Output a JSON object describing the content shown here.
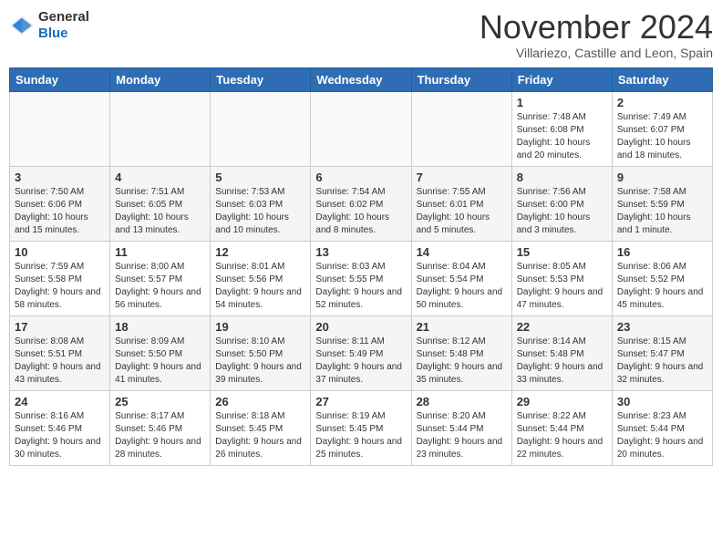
{
  "header": {
    "logo_line1": "General",
    "logo_line2": "Blue",
    "month_title": "November 2024",
    "subtitle": "Villariezo, Castille and Leon, Spain"
  },
  "days_of_week": [
    "Sunday",
    "Monday",
    "Tuesday",
    "Wednesday",
    "Thursday",
    "Friday",
    "Saturday"
  ],
  "weeks": [
    {
      "days": [
        {
          "date": "",
          "info": ""
        },
        {
          "date": "",
          "info": ""
        },
        {
          "date": "",
          "info": ""
        },
        {
          "date": "",
          "info": ""
        },
        {
          "date": "",
          "info": ""
        },
        {
          "date": "1",
          "info": "Sunrise: 7:48 AM\nSunset: 6:08 PM\nDaylight: 10 hours and 20 minutes."
        },
        {
          "date": "2",
          "info": "Sunrise: 7:49 AM\nSunset: 6:07 PM\nDaylight: 10 hours and 18 minutes."
        }
      ]
    },
    {
      "days": [
        {
          "date": "3",
          "info": "Sunrise: 7:50 AM\nSunset: 6:06 PM\nDaylight: 10 hours and 15 minutes."
        },
        {
          "date": "4",
          "info": "Sunrise: 7:51 AM\nSunset: 6:05 PM\nDaylight: 10 hours and 13 minutes."
        },
        {
          "date": "5",
          "info": "Sunrise: 7:53 AM\nSunset: 6:03 PM\nDaylight: 10 hours and 10 minutes."
        },
        {
          "date": "6",
          "info": "Sunrise: 7:54 AM\nSunset: 6:02 PM\nDaylight: 10 hours and 8 minutes."
        },
        {
          "date": "7",
          "info": "Sunrise: 7:55 AM\nSunset: 6:01 PM\nDaylight: 10 hours and 5 minutes."
        },
        {
          "date": "8",
          "info": "Sunrise: 7:56 AM\nSunset: 6:00 PM\nDaylight: 10 hours and 3 minutes."
        },
        {
          "date": "9",
          "info": "Sunrise: 7:58 AM\nSunset: 5:59 PM\nDaylight: 10 hours and 1 minute."
        }
      ]
    },
    {
      "days": [
        {
          "date": "10",
          "info": "Sunrise: 7:59 AM\nSunset: 5:58 PM\nDaylight: 9 hours and 58 minutes."
        },
        {
          "date": "11",
          "info": "Sunrise: 8:00 AM\nSunset: 5:57 PM\nDaylight: 9 hours and 56 minutes."
        },
        {
          "date": "12",
          "info": "Sunrise: 8:01 AM\nSunset: 5:56 PM\nDaylight: 9 hours and 54 minutes."
        },
        {
          "date": "13",
          "info": "Sunrise: 8:03 AM\nSunset: 5:55 PM\nDaylight: 9 hours and 52 minutes."
        },
        {
          "date": "14",
          "info": "Sunrise: 8:04 AM\nSunset: 5:54 PM\nDaylight: 9 hours and 50 minutes."
        },
        {
          "date": "15",
          "info": "Sunrise: 8:05 AM\nSunset: 5:53 PM\nDaylight: 9 hours and 47 minutes."
        },
        {
          "date": "16",
          "info": "Sunrise: 8:06 AM\nSunset: 5:52 PM\nDaylight: 9 hours and 45 minutes."
        }
      ]
    },
    {
      "days": [
        {
          "date": "17",
          "info": "Sunrise: 8:08 AM\nSunset: 5:51 PM\nDaylight: 9 hours and 43 minutes."
        },
        {
          "date": "18",
          "info": "Sunrise: 8:09 AM\nSunset: 5:50 PM\nDaylight: 9 hours and 41 minutes."
        },
        {
          "date": "19",
          "info": "Sunrise: 8:10 AM\nSunset: 5:50 PM\nDaylight: 9 hours and 39 minutes."
        },
        {
          "date": "20",
          "info": "Sunrise: 8:11 AM\nSunset: 5:49 PM\nDaylight: 9 hours and 37 minutes."
        },
        {
          "date": "21",
          "info": "Sunrise: 8:12 AM\nSunset: 5:48 PM\nDaylight: 9 hours and 35 minutes."
        },
        {
          "date": "22",
          "info": "Sunrise: 8:14 AM\nSunset: 5:48 PM\nDaylight: 9 hours and 33 minutes."
        },
        {
          "date": "23",
          "info": "Sunrise: 8:15 AM\nSunset: 5:47 PM\nDaylight: 9 hours and 32 minutes."
        }
      ]
    },
    {
      "days": [
        {
          "date": "24",
          "info": "Sunrise: 8:16 AM\nSunset: 5:46 PM\nDaylight: 9 hours and 30 minutes."
        },
        {
          "date": "25",
          "info": "Sunrise: 8:17 AM\nSunset: 5:46 PM\nDaylight: 9 hours and 28 minutes."
        },
        {
          "date": "26",
          "info": "Sunrise: 8:18 AM\nSunset: 5:45 PM\nDaylight: 9 hours and 26 minutes."
        },
        {
          "date": "27",
          "info": "Sunrise: 8:19 AM\nSunset: 5:45 PM\nDaylight: 9 hours and 25 minutes."
        },
        {
          "date": "28",
          "info": "Sunrise: 8:20 AM\nSunset: 5:44 PM\nDaylight: 9 hours and 23 minutes."
        },
        {
          "date": "29",
          "info": "Sunrise: 8:22 AM\nSunset: 5:44 PM\nDaylight: 9 hours and 22 minutes."
        },
        {
          "date": "30",
          "info": "Sunrise: 8:23 AM\nSunset: 5:44 PM\nDaylight: 9 hours and 20 minutes."
        }
      ]
    }
  ]
}
